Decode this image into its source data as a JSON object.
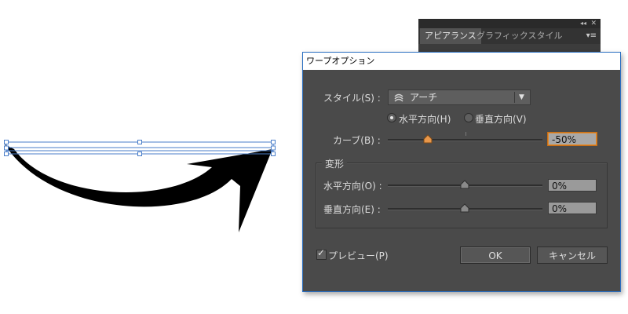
{
  "panel": {
    "tabs": [
      "アピアランス",
      "グラフィックスタイル"
    ],
    "collapse_icon": "◂◂",
    "close_icon": "✕",
    "menu_icon": "▾≡"
  },
  "dialog": {
    "title": "ワープオプション",
    "style_label": "スタイル(S) :",
    "style_value": "アーチ",
    "orientation": {
      "horizontal_label": "水平方向(H)",
      "vertical_label": "垂直方向(V)",
      "selected": "horizontal"
    },
    "bend": {
      "label": "カーブ(B) :",
      "value": "-50%",
      "slider_percent": -50
    },
    "distortion": {
      "group_label": "変形",
      "horizontal": {
        "label": "水平方向(O) :",
        "value": "0%",
        "slider_percent": 0
      },
      "vertical": {
        "label": "垂直方向(E) :",
        "value": "0%",
        "slider_percent": 0
      }
    },
    "preview": {
      "label": "プレビュー(P)",
      "checked": true
    },
    "ok_label": "OK",
    "cancel_label": "キャンセル"
  }
}
